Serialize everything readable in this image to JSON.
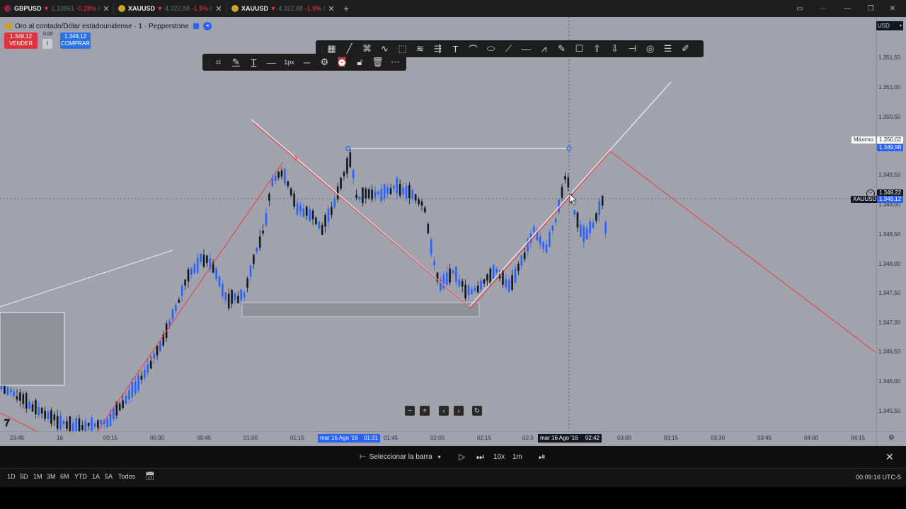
{
  "tabs": [
    {
      "symbol": "GBPUSD",
      "change_icon": "▼",
      "price": "1,33861",
      "change": "-0.28%",
      "sep": "/"
    },
    {
      "symbol": "XAUUSD",
      "change_icon": "▼",
      "price": "4.322,88",
      "change": "-1.9%",
      "sep": "/"
    },
    {
      "symbol": "XAUUSD",
      "change_icon": "▼",
      "price": "4.322,88",
      "change": "-1.9%",
      "sep": "/"
    }
  ],
  "chart": {
    "title": "Oro al contado/Dólar estadounidense · 1 · Pepperstone",
    "sell": {
      "price": "1.349,12",
      "label": "VENDER"
    },
    "buy": {
      "price": "1.349,12",
      "label": "COMPRAR"
    },
    "spread": {
      "value": "0.00",
      "box": "I"
    },
    "currency": "USD"
  },
  "toolbar1": {
    "width_label": "1px"
  },
  "price_axis": {
    "ticks": [
      "1.351,50",
      "1.351,00",
      "1.350,50",
      "1.349,50",
      "1.349,00",
      "1.348,50",
      "1.348,00",
      "1.347,50",
      "1.347,00",
      "1.346,50",
      "1.346,00",
      "1.345,50"
    ],
    "max_label": "Máximo",
    "max_value": "1.350,02",
    "high_value": "1.349,98",
    "cross_value": "1.349,22",
    "symbol_label": "XAUUSD",
    "last_value": "1.349,12"
  },
  "time_axis": {
    "ticks": [
      "23:45",
      "16",
      "00:15",
      "00:30",
      "00:45",
      "01:00",
      "01:15",
      "01:45",
      "02:00",
      "02:15",
      "02:3",
      "03:00",
      "03:15",
      "03:30",
      "03:45",
      "04:00",
      "04:15"
    ],
    "highlight1_date": "mar 16 Ago '16",
    "highlight1_time": "01:31",
    "highlight2_date": "mar 16 Ago '16",
    "highlight2_time": "02:42"
  },
  "replay": {
    "select_bar": "Seleccionar la barra",
    "speed": "10x",
    "interval": "1m"
  },
  "ranges": [
    "1D",
    "5D",
    "1M",
    "3M",
    "6M",
    "YTD",
    "1A",
    "5A",
    "Todos"
  ],
  "clock": "00:09:16 UTC-5",
  "colors": {
    "chart_bg": "#a0a3ab",
    "bull": "#2962ff",
    "bear": "#131722",
    "trend": "#f23645",
    "sell": "#e0323f",
    "buy": "#2b72e6"
  }
}
